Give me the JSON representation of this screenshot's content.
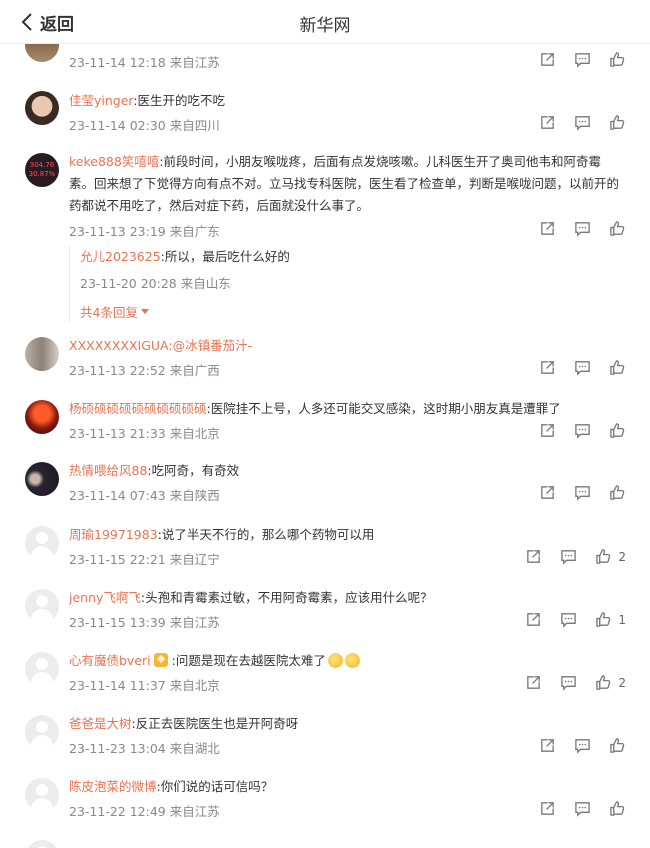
{
  "header": {
    "back_label": "返回",
    "title": "新华网"
  },
  "comments": [
    {
      "meta": "23-11-14 12:18 来自江苏"
    },
    {
      "user": "佳莹yinger",
      "text": ":医生开的吃不吃",
      "meta": "23-11-14 02:30 来自四川"
    },
    {
      "user": "keke888笑嘻嘻",
      "text": ":前段时间，小朋友喉咙疼，后面有点发烧咳嗽。儿科医生开了奥司他韦和阿奇霉素。回来想了下觉得方向有点不对。立马找专科医院，医生看了检查单，判断是喉咙问题，以前开的药都说不用吃了，然后对症下药，后面就没什么事了。",
      "meta": "23-11-13 23:19 来自广东",
      "avatar_text": [
        "304.76",
        "30.87%"
      ],
      "reply": {
        "user": "允儿2023625",
        "text": ":所以，最后吃什么好的",
        "meta": "23-11-20 20:28 来自山东",
        "more_label": "共4条回复"
      }
    },
    {
      "user": "XXXXXXXXIGUA",
      "text": ":@冰镇番茄汁-",
      "meta": "23-11-13 22:52 来自广西"
    },
    {
      "user": "杨硕硕硕硕硕硕硕硕硕硕",
      "text": ":医院挂不上号，人多还可能交叉感染，这时期小朋友真是遭罪了",
      "meta": "23-11-13 21:33 来自北京"
    },
    {
      "user": "热情喂给风88",
      "text": ":吃阿奇，有奇效",
      "meta": "23-11-14 07:43 来自陕西"
    },
    {
      "user": "周瑜19971983",
      "text": ":说了半天不行的，那么哪个药物可以用",
      "meta": "23-11-15 22:21 来自辽宁",
      "likes": "2"
    },
    {
      "user": "jenny飞啊飞",
      "text": ":头孢和青霉素过敏，不用阿奇霉素，应该用什么呢？",
      "meta": "23-11-15 13:39 来自江苏",
      "likes": "1"
    },
    {
      "user": "心有魔债bveri",
      "text": ":问题是现在去越医院太难了",
      "meta": "23-11-14 11:37 来自北京",
      "likes": "2"
    },
    {
      "user": "爸爸是大树",
      "text": ":反正去医院医生也是开阿奇呀",
      "meta": "23-11-23 13:04 来自湖北"
    },
    {
      "user": "陈皮泡菜的微博",
      "text": ":你们说的话可信吗？",
      "meta": "23-11-22 12:49 来自江苏"
    }
  ],
  "colors": {
    "username": "#eb7350",
    "meta": "#888888",
    "text": "#333333"
  }
}
